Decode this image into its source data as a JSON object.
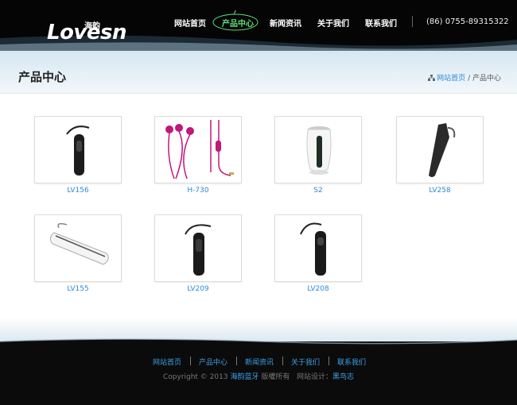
{
  "header": {
    "logo_text": "Lovesn",
    "logo_cn": "海韵",
    "nav": [
      {
        "label": "网站首页",
        "active": false
      },
      {
        "label": "产品中心",
        "active": true
      },
      {
        "label": "新闻资讯",
        "active": false
      },
      {
        "label": "关于我们",
        "active": false
      },
      {
        "label": "联系我们",
        "active": false
      }
    ],
    "phone": "(86) 0755-89315322"
  },
  "page": {
    "title": "产品中心",
    "breadcrumb": {
      "home": "网站首页",
      "separator": "/",
      "current": "产品中心"
    }
  },
  "products": [
    {
      "name": "LV156",
      "kind": "earpiece-black"
    },
    {
      "name": "H-730",
      "kind": "earphones-pink"
    },
    {
      "name": "S2",
      "kind": "speaker-white"
    },
    {
      "name": "LV258",
      "kind": "earpiece-slim"
    },
    {
      "name": "LV155",
      "kind": "earpiece-white"
    },
    {
      "name": "LV209",
      "kind": "earpiece-black"
    },
    {
      "name": "LV208",
      "kind": "earpiece-black-lovesn"
    }
  ],
  "footer": {
    "links": [
      "网站首页",
      "产品中心",
      "新闻资讯",
      "关于我们",
      "联系我们"
    ],
    "copyright_prefix": "Copyright © 2013",
    "company": "海韵蓝牙",
    "rights": "版權所有",
    "design_label": "网站设计：",
    "designer": "黑鸟志"
  },
  "colors": {
    "accent": "#2a8bd6",
    "nav_active": "#5fe07a",
    "header_bg": "#050505"
  }
}
